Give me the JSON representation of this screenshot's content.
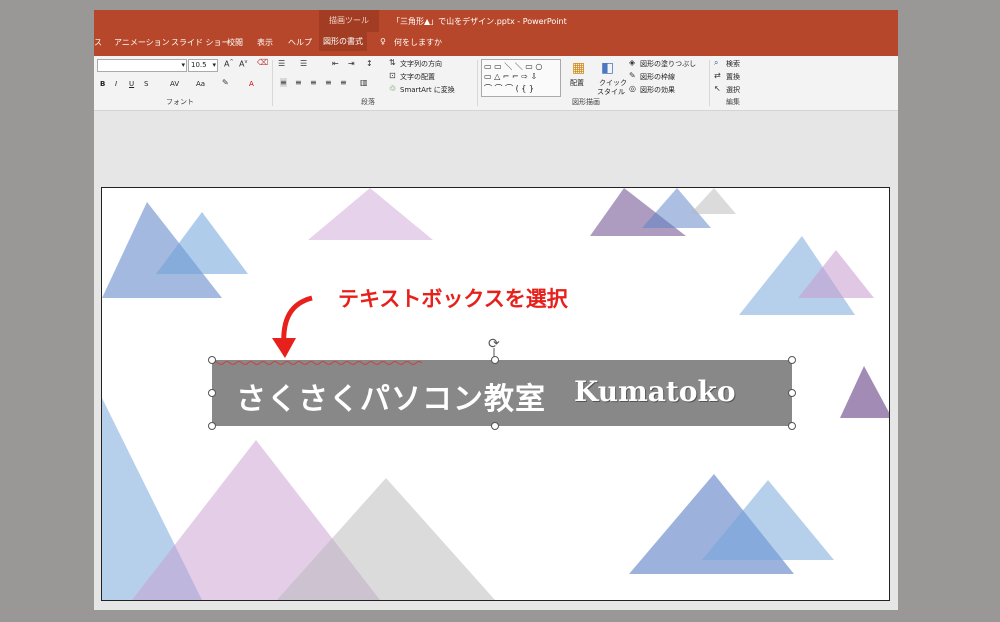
{
  "window": {
    "context_tab": "描画ツール",
    "doc_title": "「三角形▲」で山をデザイン.pptx - PowerPoint"
  },
  "tabs": [
    {
      "label": "ス"
    },
    {
      "label": "アニメーション"
    },
    {
      "label": "スライド ショー"
    },
    {
      "label": "校閲"
    },
    {
      "label": "表示"
    },
    {
      "label": "ヘルプ"
    },
    {
      "label": "図形の書式"
    },
    {
      "label": "何をしますか"
    }
  ],
  "ribbon": {
    "font": {
      "name_value": "",
      "size_value": "10.5",
      "label": "フォント",
      "buttons": [
        "B",
        "I",
        "U",
        "S",
        "AV",
        "Aa",
        "A"
      ]
    },
    "paragraph": {
      "label": "段落",
      "text_direction": "文字列の方向",
      "text_align": "文字の配置",
      "smartart": "SmartArt に変換"
    },
    "drawing": {
      "label": "図形描画",
      "arrange": "配置",
      "quick_styles_1": "クイック",
      "quick_styles_2": "スタイル",
      "shape_fill": "図形の塗りつぶし",
      "shape_outline": "図形の枠線",
      "shape_effects": "図形の効果"
    },
    "editing": {
      "label": "編集",
      "find": "検索",
      "replace": "置換",
      "select": "選択"
    }
  },
  "slide": {
    "textbox_text1": "さくさくパソコン教室",
    "textbox_text2": "Kumatoko",
    "annotation": "テキストボックスを選択"
  },
  "colors": {
    "titlebar": "#b7472a",
    "annotation": "#e8201c",
    "textbox": "#888888"
  }
}
